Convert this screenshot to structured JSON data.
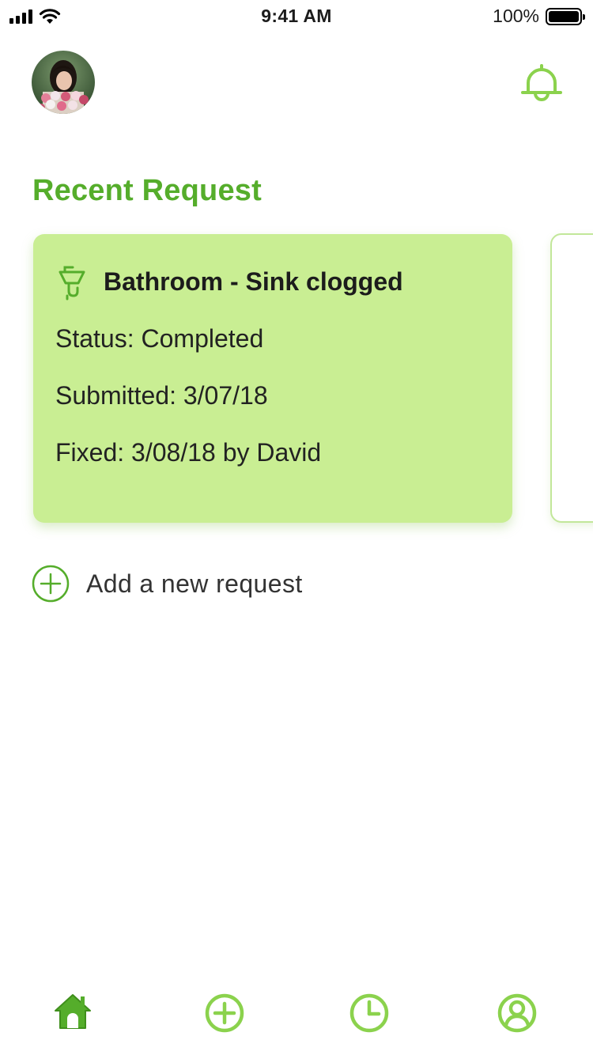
{
  "status_bar": {
    "time": "9:41 AM",
    "battery": "100%"
  },
  "header": {
    "avatar": "user-avatar-photo",
    "notification_icon": "bell-icon"
  },
  "section": {
    "title": "Recent Request"
  },
  "requests": [
    {
      "icon": "sink-icon",
      "title": "Bathroom - Sink clogged",
      "status": "Status: Completed",
      "submitted": "Submitted: 3/07/18",
      "fixed": "Fixed: 3/08/18 by David"
    }
  ],
  "add_request": {
    "label": "Add a new request",
    "icon": "plus-circle-icon"
  },
  "tab_bar": {
    "items": [
      {
        "name": "home",
        "icon": "home-icon",
        "active": true
      },
      {
        "name": "add",
        "icon": "plus-circle-icon",
        "active": false
      },
      {
        "name": "history",
        "icon": "clock-icon",
        "active": false
      },
      {
        "name": "profile",
        "icon": "user-icon",
        "active": false
      }
    ]
  },
  "colors": {
    "accent": "#55ad2b",
    "icon_light": "#8bd24d",
    "card_bg": "#c9ee93"
  }
}
